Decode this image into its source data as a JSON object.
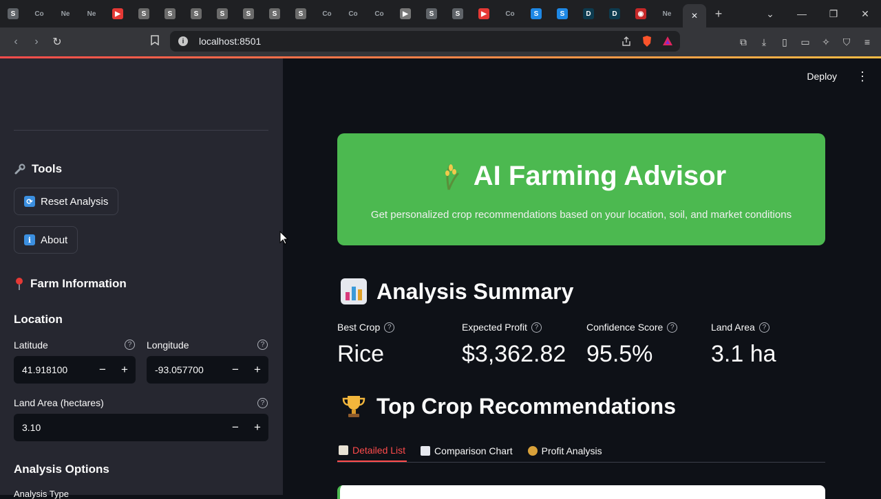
{
  "browser": {
    "tabs": [
      {
        "label": "S",
        "color": "#5f6368"
      },
      {
        "label": "Co",
        "color": ""
      },
      {
        "label": "Ne",
        "color": ""
      },
      {
        "label": "Ne",
        "color": ""
      },
      {
        "label": "▶",
        "color": "#e53935"
      },
      {
        "label": "S",
        "color": "#6b6b6b"
      },
      {
        "label": "S",
        "color": "#6b6b6b"
      },
      {
        "label": "S",
        "color": "#6b6b6b"
      },
      {
        "label": "S",
        "color": "#6b6b6b"
      },
      {
        "label": "S",
        "color": "#6b6b6b"
      },
      {
        "label": "S",
        "color": "#6b6b6b"
      },
      {
        "label": "S",
        "color": "#6b6b6b"
      },
      {
        "label": "Co",
        "color": ""
      },
      {
        "label": "Co",
        "color": ""
      },
      {
        "label": "Co",
        "color": ""
      },
      {
        "label": "▶",
        "color": "#777"
      },
      {
        "label": "S",
        "color": "#5f6368"
      },
      {
        "label": "S",
        "color": "#5f6368"
      },
      {
        "label": "▶",
        "color": "#e53935"
      },
      {
        "label": "Co",
        "color": ""
      },
      {
        "label": "S",
        "color": "#1e88e5"
      },
      {
        "label": "S",
        "color": "#1e88e5"
      },
      {
        "label": "D",
        "color": "#0d3b4f"
      },
      {
        "label": "D",
        "color": "#0d3b4f"
      },
      {
        "label": "◉",
        "color": "#c62828"
      },
      {
        "label": "Ne",
        "color": ""
      }
    ],
    "active_tab_close": "✕",
    "new_tab": "+",
    "url": "localhost:8501"
  },
  "app": {
    "deploy_label": "Deploy",
    "menu_label": "⋮"
  },
  "sidebar": {
    "tools_heading": "Tools",
    "reset_button": "Reset Analysis",
    "about_button": "About",
    "farm_heading": "Farm Information",
    "location_heading": "Location",
    "latitude_label": "Latitude",
    "latitude_value": "41.918100",
    "longitude_label": "Longitude",
    "longitude_value": "-93.057700",
    "land_area_label": "Land Area (hectares)",
    "land_area_value": "3.10",
    "analysis_heading": "Analysis Options",
    "analysis_type_label": "Analysis Type"
  },
  "hero": {
    "title": "AI Farming Advisor",
    "subtitle": "Get personalized crop recommendations based on your location, soil, and market conditions",
    "color": "#4cb950"
  },
  "summary": {
    "heading": "Analysis Summary",
    "metrics": [
      {
        "label": "Best Crop",
        "value": "Rice"
      },
      {
        "label": "Expected Profit",
        "value": "$3,362.82"
      },
      {
        "label": "Confidence Score",
        "value": "95.5%"
      },
      {
        "label": "Land Area",
        "value": "3.1 ha"
      }
    ]
  },
  "recommendations": {
    "heading": "Top Crop Recommendations",
    "tabs": [
      {
        "label": "Detailed List",
        "active": true
      },
      {
        "label": "Comparison Chart",
        "active": false
      },
      {
        "label": "Profit Analysis",
        "active": false
      }
    ]
  },
  "theme": {
    "accent": "#ff4b4b",
    "sidebar_bg": "#262730",
    "main_bg": "#0e1117"
  }
}
